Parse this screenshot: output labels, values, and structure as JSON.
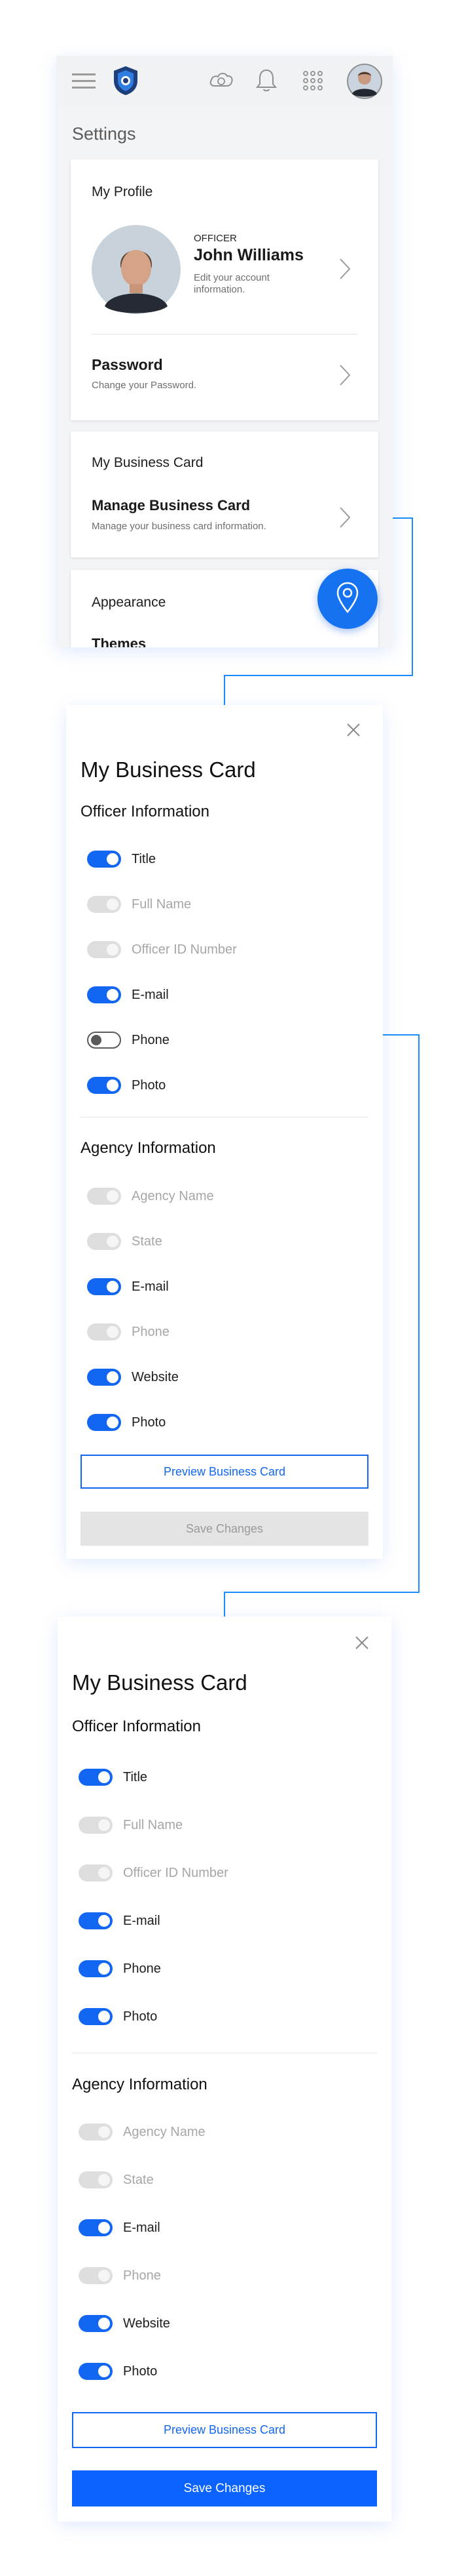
{
  "colors": {
    "accent": "#1266f1",
    "connector": "#1a8cff",
    "disabled": "#dedede"
  },
  "settings": {
    "title": "Settings",
    "topbar_icons": [
      "menu-icon",
      "shield-logo-icon",
      "cloud-sync-icon",
      "bell-icon",
      "apps-grid-icon",
      "avatar"
    ],
    "profile": {
      "heading": "My Profile",
      "role": "OFFICER",
      "name": "John Williams",
      "desc": "Edit your account information."
    },
    "password": {
      "label": "Password",
      "desc": "Change your Password."
    },
    "business_card": {
      "heading": "My Business Card",
      "manage_label": "Manage Business Card",
      "manage_desc": "Manage your business card information."
    },
    "appearance": {
      "heading": "Appearance",
      "themes_label": "Themes"
    },
    "fab_icon": "location-pin-icon"
  },
  "card_before": {
    "title": "My Business Card",
    "officer_heading": "Officer Information",
    "officer_items": [
      {
        "label": "Title",
        "state": "on"
      },
      {
        "label": "Full Name",
        "state": "disabled"
      },
      {
        "label": "Officer ID Number",
        "state": "disabled"
      },
      {
        "label": "E-mail",
        "state": "on"
      },
      {
        "label": "Phone",
        "state": "off"
      },
      {
        "label": "Photo",
        "state": "on"
      }
    ],
    "agency_heading": "Agency Information",
    "agency_items": [
      {
        "label": "Agency Name",
        "state": "disabled"
      },
      {
        "label": "State",
        "state": "disabled"
      },
      {
        "label": "E-mail",
        "state": "on"
      },
      {
        "label": "Phone",
        "state": "disabled"
      },
      {
        "label": "Website",
        "state": "on"
      },
      {
        "label": "Photo",
        "state": "on"
      }
    ],
    "preview_label": "Preview Business Card",
    "save_label": "Save Changes",
    "save_enabled": false
  },
  "card_after": {
    "title": "My Business Card",
    "officer_heading": "Officer Information",
    "officer_items": [
      {
        "label": "Title",
        "state": "on"
      },
      {
        "label": "Full Name",
        "state": "disabled"
      },
      {
        "label": "Officer ID Number",
        "state": "disabled"
      },
      {
        "label": "E-mail",
        "state": "on"
      },
      {
        "label": "Phone",
        "state": "on"
      },
      {
        "label": "Photo",
        "state": "on"
      }
    ],
    "agency_heading": "Agency Information",
    "agency_items": [
      {
        "label": "Agency Name",
        "state": "disabled"
      },
      {
        "label": "State",
        "state": "disabled"
      },
      {
        "label": "E-mail",
        "state": "on"
      },
      {
        "label": "Phone",
        "state": "disabled"
      },
      {
        "label": "Website",
        "state": "on"
      },
      {
        "label": "Photo",
        "state": "on"
      }
    ],
    "preview_label": "Preview Business Card",
    "save_label": "Save Changes",
    "save_enabled": true
  }
}
